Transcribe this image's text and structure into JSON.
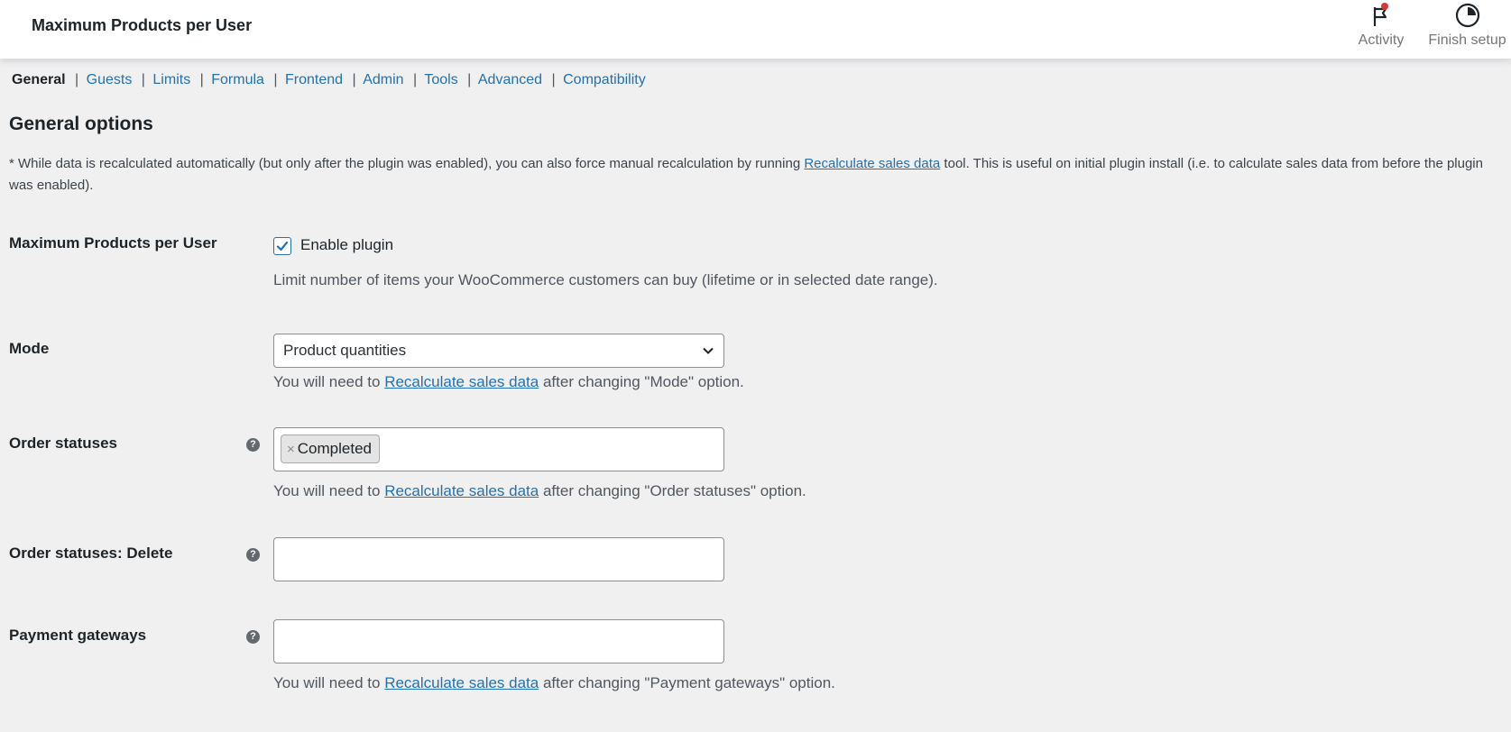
{
  "header": {
    "title": "Maximum Products per User",
    "actions": [
      {
        "label": "Activity",
        "icon": "flag-icon"
      },
      {
        "label": "Finish setup",
        "icon": "progress-circle-icon"
      }
    ]
  },
  "tabs": [
    {
      "label": "General",
      "current": true
    },
    {
      "label": "Guests"
    },
    {
      "label": "Limits"
    },
    {
      "label": "Formula"
    },
    {
      "label": "Frontend"
    },
    {
      "label": "Admin"
    },
    {
      "label": "Tools"
    },
    {
      "label": "Advanced"
    },
    {
      "label": "Compatibility"
    }
  ],
  "tab_separator": "|",
  "section": {
    "title": "General options",
    "intro_before": "* While data is recalculated automatically (but only after the plugin was enabled), you can also force manual recalculation by running ",
    "intro_link": "Recalculate sales data",
    "intro_after": " tool. This is useful on initial plugin install (i.e. to calculate sales data from before the plugin was enabled)."
  },
  "fields": {
    "plugin": {
      "label": "Maximum Products per User",
      "checkbox_label": "Enable plugin",
      "checked": true,
      "description": "Limit number of items your WooCommerce customers can buy (lifetime or in selected date range)."
    },
    "mode": {
      "label": "Mode",
      "selected": "Product quantities",
      "desc_before": "You will need to ",
      "desc_link": "Recalculate sales data",
      "desc_after": " after changing \"Mode\" option."
    },
    "order_statuses": {
      "label": "Order statuses",
      "help": "?",
      "tags": [
        "Completed"
      ],
      "tag_remove": "×",
      "desc_before": "You will need to ",
      "desc_link": "Recalculate sales data",
      "desc_after": " after changing \"Order statuses\" option."
    },
    "order_statuses_delete": {
      "label": "Order statuses: Delete",
      "help": "?"
    },
    "payment_gateways": {
      "label": "Payment gateways",
      "help": "?",
      "desc_before": "You will need to ",
      "desc_link": "Recalculate sales data",
      "desc_after": " after changing \"Payment gateways\" option."
    }
  },
  "colors": {
    "accent": "#2271b1",
    "notification_dot": "#d63638",
    "background": "#f0f0f1"
  }
}
